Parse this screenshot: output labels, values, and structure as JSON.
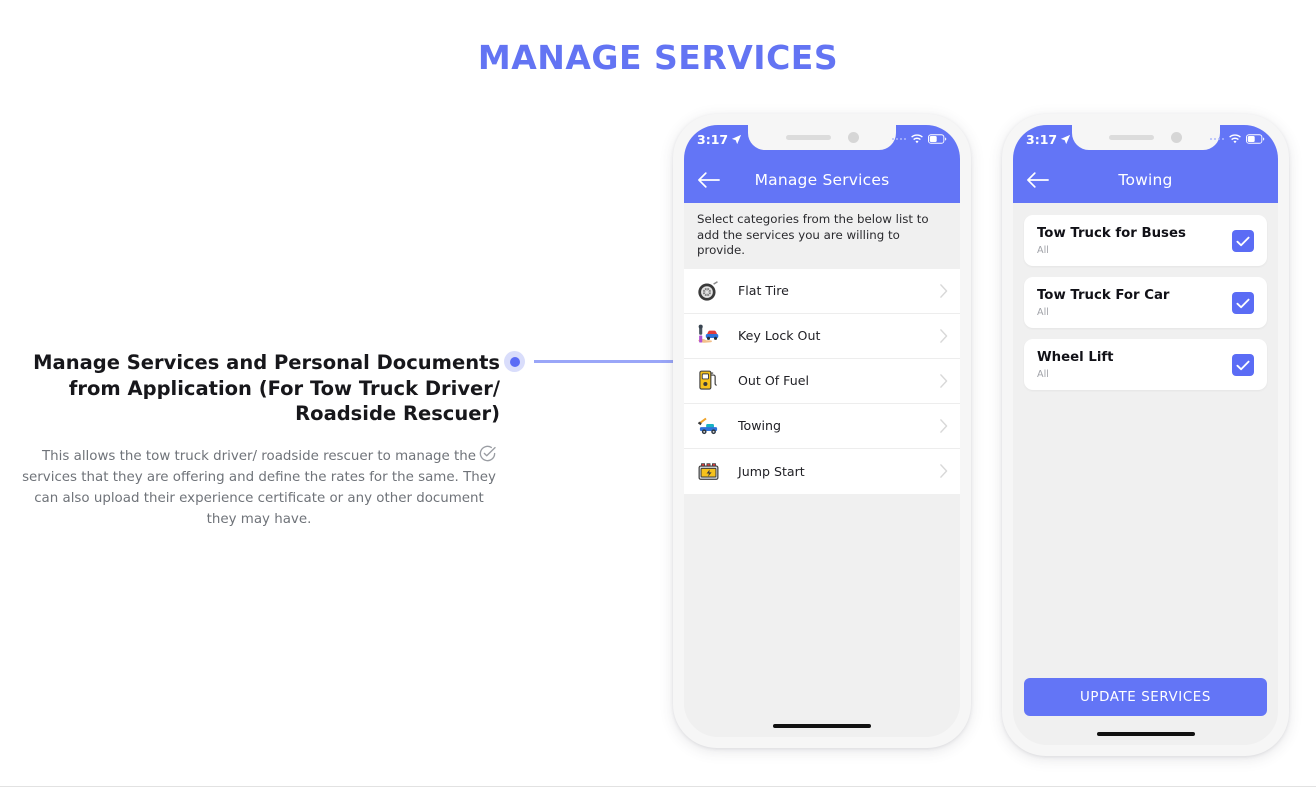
{
  "page": {
    "title": "MANAGE SERVICES",
    "accent_color": "#6374f3",
    "blue": "#6375f6",
    "checkbox_blue": "#5b6cf5"
  },
  "callout": {
    "heading": "Manage Services and Personal Documents from Application (For Tow Truck Driver/ Roadside Rescuer)",
    "body": "This allows the tow truck driver/ roadside rescuer to manage the services that they are offering and define the rates for the same. They can also upload their experience certificate or any other document they may have.",
    "check_icon": "check-circle-icon"
  },
  "phone1": {
    "status": {
      "time": "3:17",
      "location_icon": "location-arrow-icon",
      "wifi_icon": "wifi-icon",
      "battery_icon": "battery-icon"
    },
    "header": {
      "back_icon": "back-arrow-icon",
      "title": "Manage Services"
    },
    "hint": "Select categories from the below list to add the services you are willing to provide.",
    "services": [
      {
        "label": "Flat Tire",
        "icon": "tire-icon"
      },
      {
        "label": "Key Lock Out",
        "icon": "car-key-icon"
      },
      {
        "label": "Out Of Fuel",
        "icon": "fuel-pump-icon"
      },
      {
        "label": "Towing",
        "icon": "tow-truck-icon"
      },
      {
        "label": "Jump Start",
        "icon": "battery-jump-icon"
      }
    ]
  },
  "phone2": {
    "status": {
      "time": "3:17",
      "location_icon": "location-arrow-icon",
      "wifi_icon": "wifi-icon",
      "battery_icon": "battery-icon"
    },
    "header": {
      "back_icon": "back-arrow-icon",
      "title": "Towing"
    },
    "items": [
      {
        "title": "Tow Truck for Buses",
        "subtitle": "All",
        "checked": true
      },
      {
        "title": "Tow Truck For Car",
        "subtitle": "All",
        "checked": true
      },
      {
        "title": "Wheel Lift",
        "subtitle": "All",
        "checked": true
      }
    ],
    "update_button": "UPDATE SERVICES"
  }
}
